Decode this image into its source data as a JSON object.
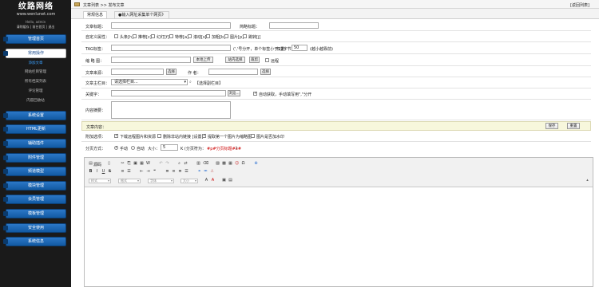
{
  "sidebar": {
    "logo_title": "纹路网络",
    "logo_url": "www.wenlunet.com",
    "user": "Hello, admin",
    "user_links": "清除缓存 | 前台首页 | 退出",
    "nav": [
      {
        "label": "管理首页"
      },
      {
        "label": "常用操作",
        "active": true
      },
      {
        "label": "系统设置"
      },
      {
        "label": "HTML更新"
      },
      {
        "label": "辅助插件"
      },
      {
        "label": "附件管理"
      },
      {
        "label": "频道模型"
      },
      {
        "label": "模块管理"
      },
      {
        "label": "会员管理"
      },
      {
        "label": "模板管理"
      },
      {
        "label": "安全使用"
      },
      {
        "label": "系统信息"
      }
    ],
    "sub_items": [
      "添加文章",
      "网站栏目管理",
      "所有档案列表",
      "评论管理",
      "内容回收站"
    ]
  },
  "topbar": {
    "crumb": "文章列表 >> 发布文章",
    "back": "[返回列表]"
  },
  "tabs": [
    "常规信息",
    "●输入网址采集单个网页》"
  ],
  "form": {
    "title_label": "文章标题：",
    "short_title_label": "简略标题：",
    "flags_label": "自定义属性：",
    "flags": [
      "头条[h]",
      "推荐[c]",
      "幻灯[f]",
      "特荐[a]",
      "滚动[s]",
      "加粗[b]",
      "图片[p]",
      "跳转[j]"
    ],
    "tag_label": "TAG标签：",
    "tag_hint": "(','号分开，单个标签小于12字节)",
    "weight_label": "权重：",
    "weight_value": "50",
    "weight_hint": "(越小越靠前)",
    "thumb_label": "缩 略 图：",
    "upload_btn": "本地上传",
    "site_select_btn": "站内选择",
    "crop_btn": "裁剪",
    "remote_label": "远程",
    "source_label": "文章来源：",
    "source_btn": "选择",
    "author_label": "作 者：",
    "author_btn": "选择",
    "column_label": "文章主栏目：",
    "column_select": "请选择栏目...",
    "column_extra": "【选择副栏目】",
    "keywords_label": "关键字：",
    "keywords_btn": "浏览...",
    "keywords_auto": "自动获取，手动填写用\",\"分开",
    "summary_label": "内容摘要：",
    "content_label": "文章内容：",
    "save_btn": "保存",
    "reset_btn": "重置",
    "options_label": "附加选项：",
    "opt1": "下载远程图片和资源",
    "opt2": "删除非站内链接 [设置]",
    "opt3": "提取第一个图片为缩略图",
    "opt4": "图片是否加水印",
    "paging_label": "分页方式：",
    "paging_manual": "手动",
    "paging_auto": "自动",
    "paging_size_label": "大小：",
    "paging_size_value": "5",
    "paging_unit": "K (分页符为：",
    "paging_tag": "#p#分页标题#e#",
    "paging_close": ")"
  },
  "editor": {
    "source_label": "源码",
    "dropdowns": [
      "样式",
      "格式",
      "字体",
      "大小"
    ]
  }
}
